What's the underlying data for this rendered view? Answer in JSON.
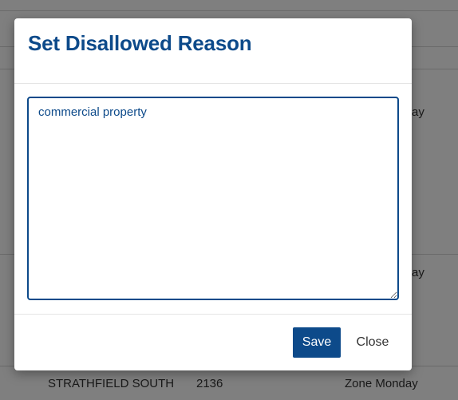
{
  "background": {
    "table": {
      "rows": [
        {
          "day": "ay"
        },
        {
          "day": "ay"
        },
        {
          "suburb": "STRATHFIELD SOUTH",
          "postcode": "2136",
          "zone_day": "Zone Monday"
        }
      ]
    }
  },
  "modal": {
    "title": "Set Disallowed Reason",
    "reason_value": "commercial property",
    "save_label": "Save",
    "close_label": "Close"
  },
  "colors": {
    "primary": "#0d4a8a",
    "backdrop": "rgba(0,0,0,0.5)"
  }
}
